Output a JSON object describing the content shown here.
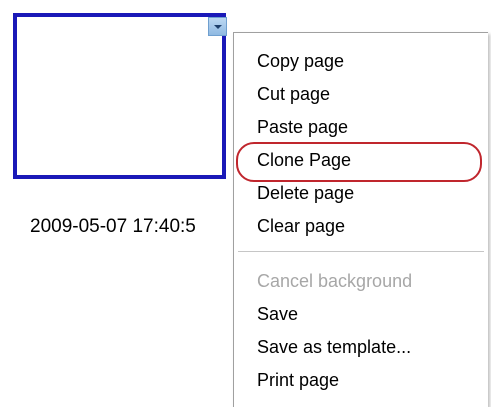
{
  "thumbnail": {
    "timestamp": "2009-05-07 17:40:5"
  },
  "context_menu": {
    "items": [
      {
        "label": "Copy page",
        "enabled": true
      },
      {
        "label": "Cut page",
        "enabled": true
      },
      {
        "label": "Paste page",
        "enabled": true
      },
      {
        "label": "Clone Page",
        "enabled": true,
        "highlighted": true
      },
      {
        "label": "Delete page",
        "enabled": true
      },
      {
        "label": "Clear page",
        "enabled": true
      },
      {
        "label": "Cancel background",
        "enabled": false
      },
      {
        "label": "Save",
        "enabled": true
      },
      {
        "label": "Save as template...",
        "enabled": true
      },
      {
        "label": "Print page",
        "enabled": true
      }
    ]
  },
  "colors": {
    "thumbnail_border": "#1a19b8",
    "highlight_oval": "#c0262d",
    "disabled_text": "#a7a7a7"
  },
  "icons": {
    "dropdown": "chevron-down-icon"
  }
}
